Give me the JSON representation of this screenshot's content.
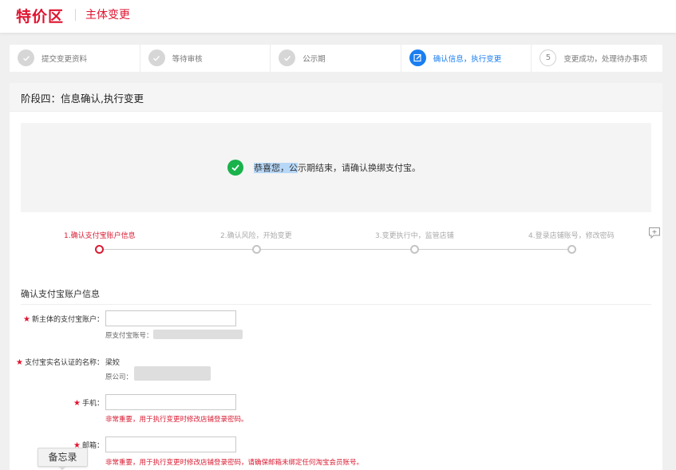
{
  "header": {
    "brand": "特价区",
    "page_name": "主体变更",
    "brand_color": "#e0132f"
  },
  "steps": [
    {
      "label": "提交变更资料",
      "state": "done",
      "icon": "check-icon"
    },
    {
      "label": "等待审核",
      "state": "done",
      "icon": "check-icon"
    },
    {
      "label": "公示期",
      "state": "done",
      "icon": "check-icon"
    },
    {
      "label": "确认信息，执行变更",
      "state": "active",
      "icon": "edit-icon"
    },
    {
      "label": "变更成功，处理待办事项",
      "state": "todo",
      "number": "5"
    }
  ],
  "stage": {
    "title": "阶段四：信息确认,执行变更"
  },
  "notice": {
    "text_highlight": "恭喜您，公",
    "text_rest": "示期结束，请确认换绑支付宝。",
    "icon": "success-check-icon"
  },
  "substeps": [
    {
      "label": "1.确认支付宝账户信息",
      "current": true
    },
    {
      "label": "2.确认风险，开始变更",
      "current": false
    },
    {
      "label": "3.变更执行中，监管店铺",
      "current": false
    },
    {
      "label": "4.登录店铺账号，修改密码",
      "current": false
    }
  ],
  "form": {
    "section_title": "确认支付宝账户信息",
    "alipay_label": "新主体的支付宝账户：",
    "alipay_value": "",
    "alipay_hint": "原支付宝账号：",
    "realname_label": "支付宝实名认证的名称：",
    "realname_value": "梁姣",
    "realname_hint": "原公司：",
    "phone_label": "手机：",
    "phone_value": "",
    "phone_hint": "非常重要，用于执行变更时修改店铺登录密码。",
    "email_label": "邮箱：",
    "email_value": "",
    "email_hint": "非常重要，用于执行变更时修改店铺登录密码，请确保邮箱未绑定任何淘宝会员账号。",
    "required_mark": "★"
  },
  "memo": {
    "label": "备忘录"
  },
  "colors": {
    "accent_red": "#d91b32",
    "active_blue": "#1a7ef0",
    "success_green": "#19b24b"
  }
}
